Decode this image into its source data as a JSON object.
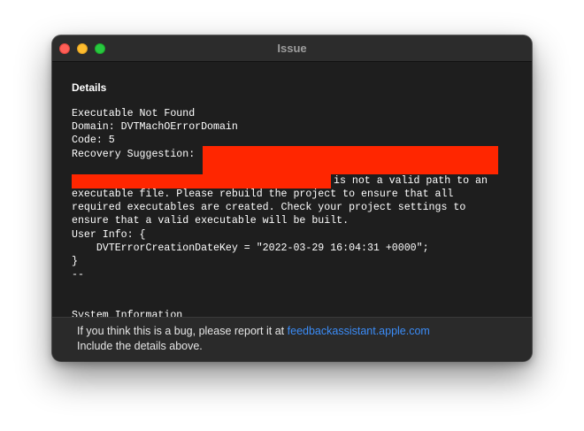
{
  "window": {
    "title": "Issue"
  },
  "details": {
    "heading": "Details",
    "lines": [
      "Executable Not Found",
      "Domain: DVTMachOErrorDomain",
      "Code: 5",
      "Recovery Suggestion:",
      "",
      "is not a valid path to an",
      "executable file. Please rebuild the project to ensure that all",
      "required executables are created. Check your project settings to",
      "ensure that a valid executable will be built.",
      "User Info: {",
      "    DVTErrorCreationDateKey = \"2022-03-29 16:04:31 +0000\";",
      "}",
      "--"
    ],
    "system_info_label": "System Information"
  },
  "footer": {
    "report_prefix": "If you think this is a bug, please report it at ",
    "report_link": "feedbackassistant.apple.com",
    "include_text": "Include the details above."
  },
  "colors": {
    "window_bg": "#1e1e1e",
    "redaction": "#ff2600",
    "link": "#3b8cf7"
  }
}
